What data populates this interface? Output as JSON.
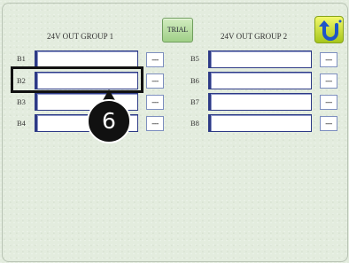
{
  "group1": {
    "title": "24V OUT GROUP 1"
  },
  "group2": {
    "title": "24V OUT GROUP 2"
  },
  "toolbar": {
    "trial_label": "TRIAL",
    "back_icon": "return-arrow-icon"
  },
  "rows_group1": [
    {
      "label": "B1",
      "value": "",
      "button_label": "---"
    },
    {
      "label": "B2",
      "value": "",
      "button_label": "---"
    },
    {
      "label": "B3",
      "value": "",
      "button_label": "---"
    },
    {
      "label": "B4",
      "value": "",
      "button_label": "---"
    }
  ],
  "rows_group2": [
    {
      "label": "B5",
      "value": "",
      "button_label": "---"
    },
    {
      "label": "B6",
      "value": "",
      "button_label": "---"
    },
    {
      "label": "B7",
      "value": "",
      "button_label": "---"
    },
    {
      "label": "B8",
      "value": "",
      "button_label": "---"
    }
  ],
  "callout": {
    "number": "6"
  },
  "colors": {
    "field_border": "#2d3a86",
    "trial_bg": "#b5dd9d",
    "back_bg": "#d4e23a"
  }
}
